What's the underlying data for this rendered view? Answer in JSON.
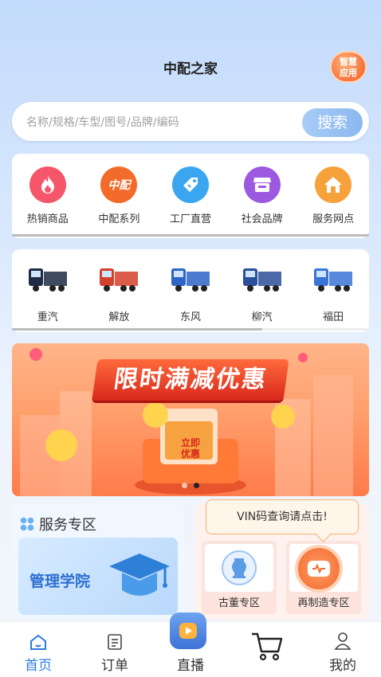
{
  "header": {
    "title": "中配之家",
    "smart_app_line1": "智慧",
    "smart_app_line2": "应用"
  },
  "search": {
    "placeholder": "名称/规格/车型/图号/品牌/编码",
    "button_label": "搜索"
  },
  "categories": [
    {
      "label": "热销商品",
      "icon": "fire-icon",
      "color": "#f5566a"
    },
    {
      "label": "中配系列",
      "icon": "zhongpei-logo-icon",
      "color": "#f26b2a"
    },
    {
      "label": "工厂直营",
      "icon": "tag-icon",
      "color": "#3aa6f0"
    },
    {
      "label": "社会品牌",
      "icon": "shop-icon",
      "color": "#9b59e0"
    },
    {
      "label": "服务网点",
      "icon": "house-icon",
      "color": "#f6a13a"
    }
  ],
  "category_scroll": {
    "progress": 1.0
  },
  "trucks": [
    {
      "label": "重汽",
      "color": "#1f2a44"
    },
    {
      "label": "解放",
      "color": "#d5402c"
    },
    {
      "label": "东风",
      "color": "#2e64c8"
    },
    {
      "label": "柳汽",
      "color": "#2b4f9a"
    },
    {
      "label": "福田",
      "color": "#3a74d6"
    }
  ],
  "truck_scroll": {
    "progress": 0.7
  },
  "banner": {
    "title": "限时满减优惠",
    "cta_line1": "立即",
    "cta_line2": "优惠"
  },
  "service_zone": {
    "title": "服务专区",
    "academy_label": "管理学院"
  },
  "special_zone": {
    "item1_label": "古董专区",
    "item2_label": "再制造专区"
  },
  "tooltip": {
    "text": "VIN码查询请点击!"
  },
  "tabbar": [
    {
      "label": "首页",
      "icon": "home-icon",
      "active": true
    },
    {
      "label": "订单",
      "icon": "order-icon",
      "active": false
    },
    {
      "label": "直播",
      "icon": "live-icon",
      "active": false
    },
    {
      "label": "",
      "icon": "cart-icon",
      "active": false
    },
    {
      "label": "我的",
      "icon": "user-icon",
      "active": false
    }
  ]
}
